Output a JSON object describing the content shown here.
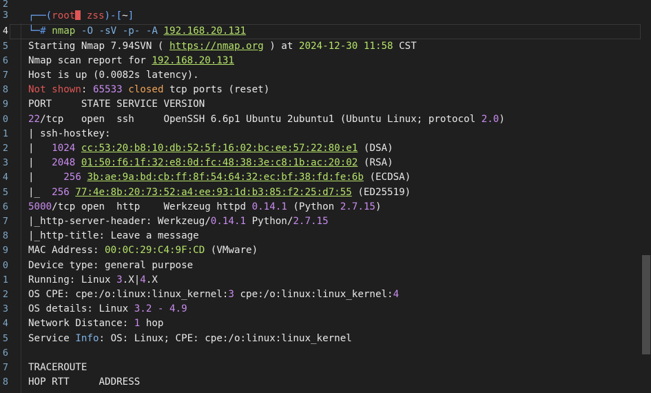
{
  "lines": [
    {
      "n": "2"
    },
    {
      "n": "3"
    },
    {
      "n": "4"
    },
    {
      "n": "5"
    },
    {
      "n": "6"
    },
    {
      "n": "7"
    },
    {
      "n": "8"
    },
    {
      "n": "9"
    },
    {
      "n": "0"
    },
    {
      "n": "1"
    },
    {
      "n": "2"
    },
    {
      "n": "3"
    },
    {
      "n": "4"
    },
    {
      "n": "5"
    },
    {
      "n": "6"
    },
    {
      "n": "7"
    },
    {
      "n": "8"
    },
    {
      "n": "9"
    },
    {
      "n": "0"
    },
    {
      "n": "1"
    },
    {
      "n": "2"
    },
    {
      "n": "3"
    },
    {
      "n": "4"
    },
    {
      "n": "5"
    },
    {
      "n": "6"
    },
    {
      "n": "7"
    },
    {
      "n": "8"
    }
  ],
  "prompt": {
    "top_prefix": "┌──(",
    "user": "root",
    "host": "zss",
    "dir_prefix": ")-[",
    "dir": "~",
    "dir_suffix": "]",
    "bottom_prefix": "└─",
    "hash": "#",
    "command": "nmap",
    "args": "-O -sV -p- -A",
    "target": "192.168.20.131"
  },
  "output": {
    "start_pre": "Starting Nmap 7.94SVN ( ",
    "start_url": "https://nmap.org",
    "start_mid": " ) at ",
    "start_date": "2024-12-30 11:58",
    "start_tz": " CST",
    "report_pre": "Nmap scan report for ",
    "report_ip": "192.168.20.131",
    "host_up": "Host is up (0.0082s latency).",
    "not_shown": "Not shown",
    "not_shown_count": "65533",
    "closed": "closed",
    "closed_tail": " tcp ports (reset)",
    "header": "PORT     STATE SERVICE VERSION",
    "ssh_port": "22",
    "ssh_rest": "/tcp   open  ssh     OpenSSH 6.6p1 Ubuntu 2ubuntu1 (Ubuntu Linux; protocol ",
    "ssh_proto": "2.0",
    "ssh_tail": ")",
    "hostkey_title": "| ssh-hostkey:",
    "hostkeys": [
      {
        "prefix": "|   ",
        "bits": "1024",
        "fp": "cc:53:20:b8:10:db:52:5f:16:02:bc:ee:57:22:80:e1",
        "type": " (DSA)"
      },
      {
        "prefix": "|   ",
        "bits": "2048",
        "fp": "01:50:f6:1f:32:e8:0d:fc:48:38:3e:c8:1b:ac:20:02",
        "type": " (RSA)"
      },
      {
        "prefix": "|   ",
        "bits": "256",
        "fp": "3b:ae:9a:bd:cb:ff:8f:54:64:32:ec:bf:38:fd:fe:6b",
        "type": " (ECDSA)"
      },
      {
        "prefix": "|_  ",
        "bits": "256",
        "fp": "77:4e:8b:20:73:52:a4:ee:93:1d:b3:85:f2:25:d7:55",
        "type": " (ED25519)"
      }
    ],
    "http_port": "5000",
    "http_rest": "/tcp open  http    Werkzeug httpd ",
    "http_ver": "0.14.1",
    "http_mid": " (Python ",
    "http_py": "2.7.15",
    "http_tail": ")",
    "server_header_pre": "|_http-server-header: Werkzeug/",
    "server_header_ver": "0.14.1",
    "server_header_mid": " Python/",
    "server_header_py": "2.7.15",
    "http_title": "|_http-title: Leave a message",
    "mac_pre": "MAC Address: ",
    "mac": "00:0C:29:C4:9F:CD",
    "mac_vendor": " (VMware)",
    "device_type": "Device type: general purpose",
    "running_pre": "Running: Linux ",
    "running_v1": "3",
    "running_x1": ".X|",
    "running_v2": "4",
    "running_x2": ".X",
    "os_cpe_pre": "OS CPE: cpe:/o:linux:linux_kernel:",
    "os_cpe_v1": "3",
    "os_cpe_mid": " cpe:/o:linux:linux_kernel:",
    "os_cpe_v2": "4",
    "os_details_pre": "OS details: Linux ",
    "os_details_v": "3.2 - 4.9",
    "net_dist_pre": "Network Distance: ",
    "net_dist_v": "1",
    "net_dist_tail": " hop",
    "service_pre": "Service ",
    "service_info": "Info",
    "service_tail": ": OS: Linux; CPE: cpe:/o:linux:linux_kernel",
    "traceroute": "TRACEROUTE",
    "hop_header": "HOP RTT     ADDRESS"
  }
}
